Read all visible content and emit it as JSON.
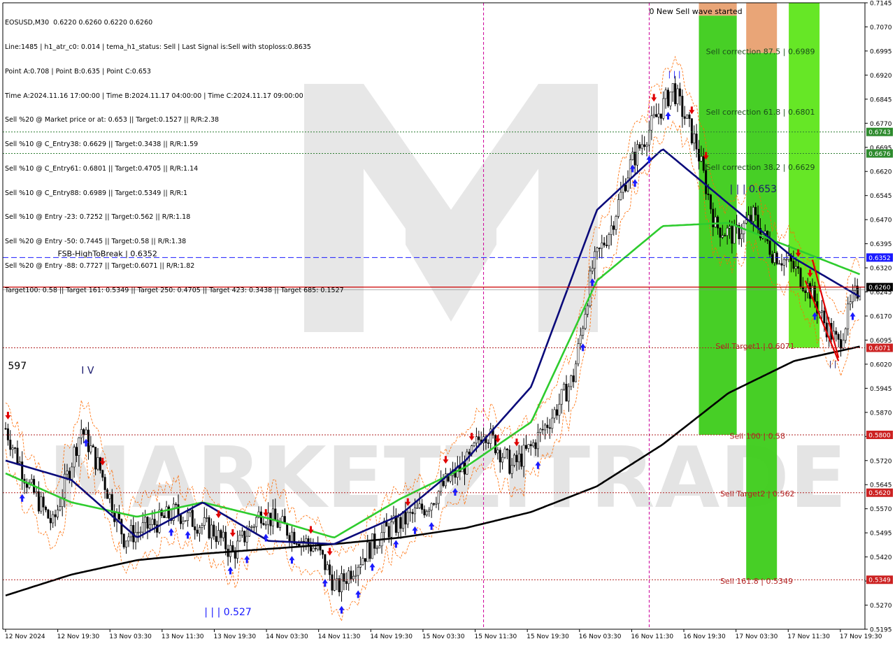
{
  "header": {
    "symbol_line": "EOSUSD,M30  0.6220 0.6260 0.6220 0.6260",
    "info_lines": [
      "Line:1485 | h1_atr_c0: 0.014 | tema_h1_status: Sell | Last Signal is:Sell with stoploss:0.8635",
      "Point A:0.708 | Point B:0.635 | Point C:0.653",
      "Time A:2024.11.16 17:00:00 | Time B:2024.11.17 04:00:00 | Time C:2024.11.17 09:00:00",
      "Sell %20 @ Market price or at: 0.653 || Target:0.1527 || R/R:2.38",
      "Sell %10 @ C_Entry38: 0.6629 || Target:0.3438 || R/R:1.59",
      "Sell %10 @ C_Entry61: 0.6801 || Target:0.4705 || R/R:1.14",
      "Sell %10 @ C_Entry88: 0.6989 || Target:0.5349 || R/R:1",
      "Sell %10 @ Entry -23: 0.7252 || Target:0.562 || R/R:1.18",
      "Sell %20 @ Entry -50: 0.7445 || Target:0.58 || R/R:1.38",
      "Sell %20 @ Entry -88: 0.7727 || Target:0.6071 || R/R:1.82",
      "Target100: 0.58 || Target 161: 0.5349 || Target 250: 0.4705 || Target 423: 0.3438 || Target 685: 0.1527"
    ]
  },
  "chart_data": {
    "type": "candlestick",
    "symbol": "EOSUSD",
    "timeframe": "M30",
    "ohlc_last": {
      "open": 0.622,
      "high": 0.626,
      "low": 0.622,
      "close": 0.626
    },
    "ylim": [
      0.5195,
      0.7145
    ],
    "y_ticks": [
      0.7145,
      0.707,
      0.6995,
      0.692,
      0.6845,
      0.677,
      0.6695,
      0.662,
      0.6545,
      0.647,
      0.6395,
      0.632,
      0.6245,
      0.617,
      0.6095,
      0.602,
      0.5945,
      0.587,
      0.5795,
      0.572,
      0.5645,
      0.557,
      0.5495,
      0.542,
      0.5345,
      0.527,
      0.5195
    ],
    "x_ticks": [
      "12 Nov 2024",
      "12 Nov 19:30",
      "13 Nov 03:30",
      "13 Nov 11:30",
      "13 Nov 19:30",
      "14 Nov 03:30",
      "14 Nov 11:30",
      "14 Nov 19:30",
      "15 Nov 03:30",
      "15 Nov 11:30",
      "15 Nov 19:30",
      "16 Nov 03:30",
      "16 Nov 11:30",
      "16 Nov 19:30",
      "17 Nov 03:30",
      "17 Nov 11:30",
      "17 Nov 19:30"
    ],
    "price_levels": [
      {
        "label": "0.6743",
        "value": 0.6743,
        "color": "#2e7d32",
        "style": "dotted",
        "tag_bg": "#2e8b2e"
      },
      {
        "label": "0.6676",
        "value": 0.6676,
        "color": "#2e7d32",
        "style": "dotted",
        "tag_bg": "#2e8b2e"
      },
      {
        "label": "0.6352",
        "value": 0.6352,
        "color": "#1a1aff",
        "style": "dashed",
        "tag_bg": "#1a1aff"
      },
      {
        "label": "0.6260",
        "value": 0.626,
        "color": "#cc0000",
        "style": "solid",
        "tag_bg": "#000000"
      },
      {
        "label": "0.6071",
        "value": 0.6071,
        "color": "#b22222",
        "style": "dotted",
        "tag_bg": "#cc2222"
      },
      {
        "label": "0.5800",
        "value": 0.58,
        "color": "#b22222",
        "style": "dotted",
        "tag_bg": "#cc2222"
      },
      {
        "label": "0.5620",
        "value": 0.562,
        "color": "#b22222",
        "style": "dotted",
        "tag_bg": "#cc2222"
      },
      {
        "label": "0.5349",
        "value": 0.5349,
        "color": "#b22222",
        "style": "dotted",
        "tag_bg": "#cc2222"
      }
    ],
    "annotations": [
      {
        "text": "0 New Sell wave started",
        "x_index": 272,
        "value": 0.711,
        "color": "#000000"
      },
      {
        "text": "Sell correction 87.5 | 0.6989",
        "x_index": 296,
        "value": 0.6985,
        "color": "#1a4d1a"
      },
      {
        "text": "Sell correction 61.8 | 0.6801",
        "x_index": 296,
        "value": 0.6797,
        "color": "#1a4d1a"
      },
      {
        "text": "Sell correction 38.2 | 0.6629",
        "x_index": 296,
        "value": 0.6625,
        "color": "#1a4d1a"
      },
      {
        "text": "| | | 0.653",
        "x_index": 306,
        "value": 0.6555,
        "color": "#1a1a6e"
      },
      {
        "text": "FSB-HighToBreak | 0.6352",
        "x_index": 22,
        "value": 0.6356,
        "color": "#000000"
      },
      {
        "text": "Sell Target1 | 0.6071",
        "x_index": 300,
        "value": 0.6068,
        "color": "#b22222"
      },
      {
        "text": "Sell 100 | 0.58",
        "x_index": 306,
        "value": 0.5788,
        "color": "#b22222"
      },
      {
        "text": "Sell Target2 | 0.562",
        "x_index": 302,
        "value": 0.5608,
        "color": "#b22222"
      },
      {
        "text": "Sell 161.8 | 0.5349",
        "x_index": 302,
        "value": 0.5337,
        "color": "#b22222"
      },
      {
        "text": "| | | 0.527",
        "x_index": 84,
        "value": 0.5238,
        "color": "#1a1aff"
      },
      {
        "text": "I V",
        "x_index": 32,
        "value": 0.599,
        "color": "#1a1a6e"
      },
      {
        "text": "597",
        "x_index": 1,
        "value": 0.6005,
        "color": "#000000"
      },
      {
        "text": "| | |",
        "x_index": 280,
        "value": 0.6915,
        "color": "#1a1aff"
      },
      {
        "text": "| |",
        "x_index": 348,
        "value": 0.6013,
        "color": "#1a1a6e"
      }
    ],
    "zones": [
      {
        "name": "sell-zone-1",
        "x_start": 293,
        "x_end": 309,
        "from": 0.58,
        "to": 0.7105,
        "color": "#3dcc1a"
      },
      {
        "name": "sell-zone-1-top",
        "x_start": 293,
        "x_end": 309,
        "from": 0.7105,
        "to": 0.718,
        "color": "#e8a070"
      },
      {
        "name": "sell-zone-2",
        "x_start": 313,
        "x_end": 326,
        "from": 0.5349,
        "to": 0.6989,
        "color": "#3dcc1a"
      },
      {
        "name": "sell-zone-2-top",
        "x_start": 313,
        "x_end": 326,
        "from": 0.6989,
        "to": 0.718,
        "color": "#e8a070"
      },
      {
        "name": "sell-zone-3",
        "x_start": 331,
        "x_end": 344,
        "from": 0.6071,
        "to": 0.718,
        "color": "#5ee61a"
      }
    ],
    "vlines": [
      {
        "x_index": 202,
        "color": "#cc0099"
      },
      {
        "x_index": 272,
        "color": "#cc0099"
      }
    ],
    "ma_series": [
      {
        "name": "MA-200",
        "color": "#000000",
        "values": [
          0.53,
          0.5365,
          0.541,
          0.543,
          0.5445,
          0.546,
          0.548,
          0.551,
          0.556,
          0.564,
          0.577,
          0.593,
          0.603,
          0.6075
        ]
      },
      {
        "name": "MA-green",
        "color": "#2ecc2e",
        "values": [
          0.568,
          0.559,
          0.5545,
          0.559,
          0.554,
          0.548,
          0.56,
          0.57,
          0.584,
          0.628,
          0.645,
          0.646,
          0.638,
          0.63
        ]
      },
      {
        "name": "MA-navy",
        "color": "#0a0a7a",
        "values": [
          0.572,
          0.566,
          0.548,
          0.559,
          0.547,
          0.546,
          0.555,
          0.572,
          0.595,
          0.65,
          0.669,
          0.652,
          0.635,
          0.623
        ]
      }
    ],
    "trend_line": {
      "color": "#e00000",
      "from": {
        "x_index": 338,
        "value": 0.628
      },
      "to": {
        "x_index": 352,
        "value": 0.603
      }
    },
    "trend_line_2": {
      "color": "#e00000",
      "from": {
        "x_index": 341,
        "value": 0.6345
      },
      "to": {
        "x_index": 352,
        "value": 0.604
      }
    },
    "signal_up_color": "#1a1aff",
    "signal_down_color": "#e00000"
  },
  "watermark": {
    "text": "MARKETZITRADE"
  }
}
